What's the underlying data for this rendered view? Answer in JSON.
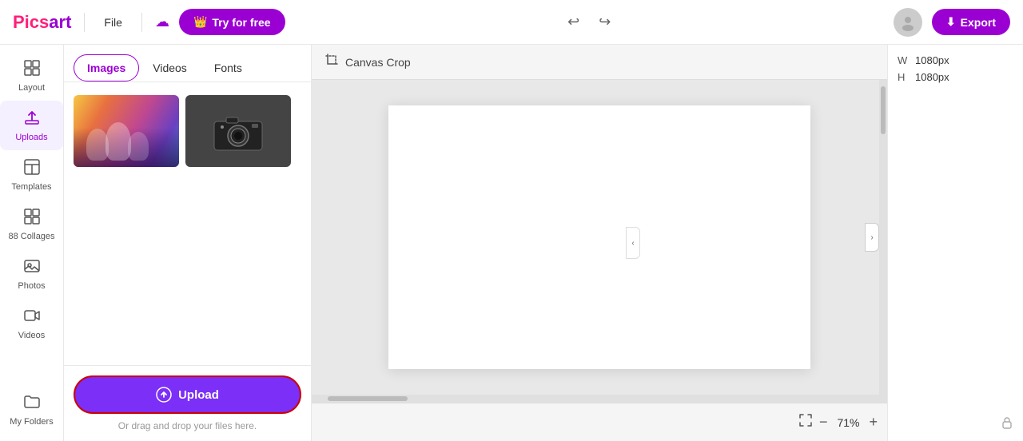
{
  "app": {
    "logo_pink": "Pics",
    "logo_purple": "art"
  },
  "topbar": {
    "file_label": "File",
    "try_free_label": "Try for free",
    "export_label": "Export",
    "crown_icon": "👑",
    "undo_icon": "↩",
    "redo_icon": "↪",
    "width_label": "W",
    "width_value": "1080px",
    "height_label": "H",
    "height_value": "1080px"
  },
  "sidebar": {
    "items": [
      {
        "id": "layout",
        "label": "Layout",
        "icon": "⊞"
      },
      {
        "id": "uploads",
        "label": "Uploads",
        "icon": "⬆",
        "active": true
      },
      {
        "id": "templates",
        "label": "Templates",
        "icon": "⊡"
      },
      {
        "id": "collages",
        "label": "88 Collages",
        "icon": "⊞"
      },
      {
        "id": "photos",
        "label": "Photos",
        "icon": "🖼"
      },
      {
        "id": "videos",
        "label": "Videos",
        "icon": "🎬"
      },
      {
        "id": "myfolders",
        "label": "My Folders",
        "icon": "📁"
      }
    ]
  },
  "panel": {
    "tabs": [
      {
        "id": "images",
        "label": "Images",
        "active": true
      },
      {
        "id": "videos",
        "label": "Videos"
      },
      {
        "id": "fonts",
        "label": "Fonts"
      }
    ],
    "upload_button_label": "Upload",
    "drag_drop_hint": "Or drag and drop your files here."
  },
  "canvas": {
    "toolbar_label": "Canvas Crop",
    "zoom_value": "71%",
    "zoom_minus": "−",
    "zoom_plus": "+"
  },
  "right_panel": {
    "width_label": "W",
    "width_value": "1080px",
    "height_label": "H",
    "height_value": "1080px"
  }
}
